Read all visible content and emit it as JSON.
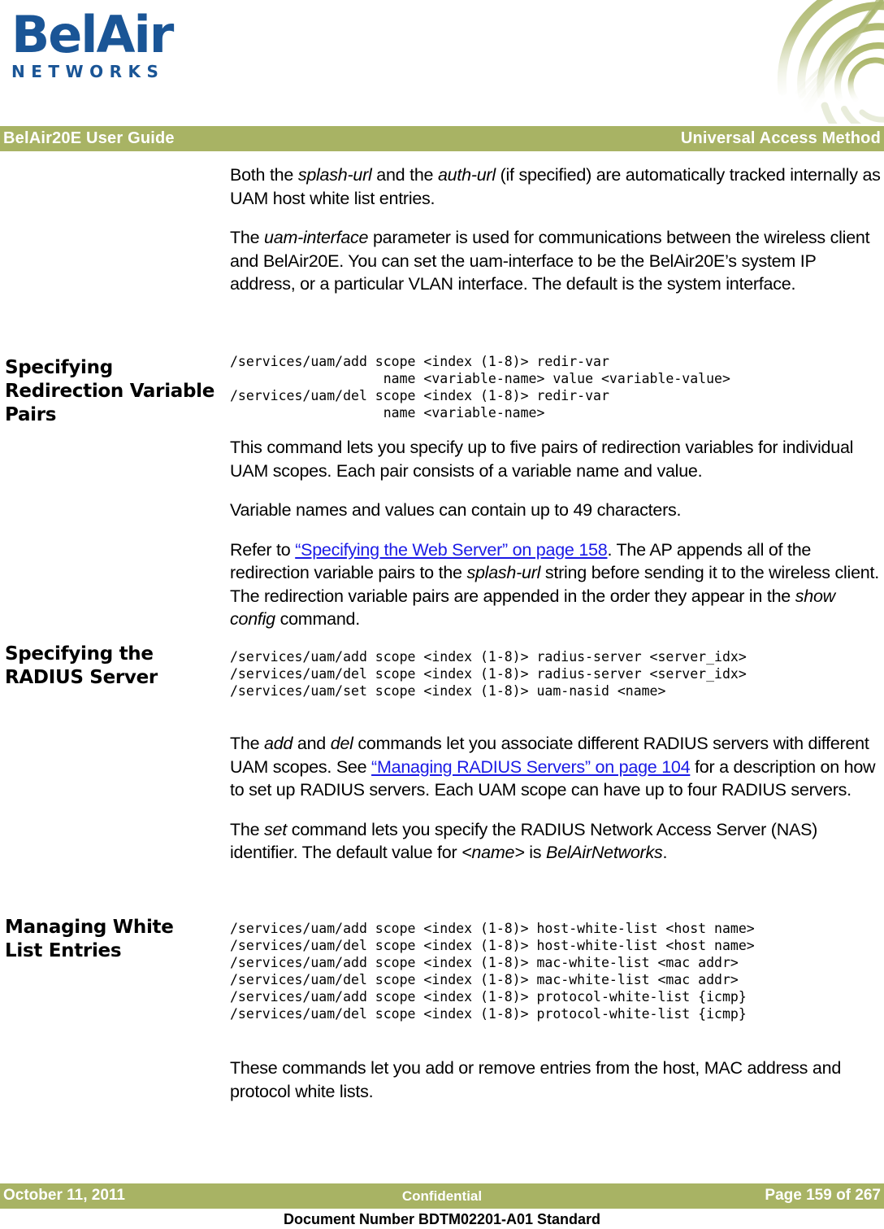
{
  "logo": {
    "wordmark": "BelAir",
    "tagline": "NETWORKS",
    "brand_color": "#1a5596",
    "corner_art_icon": "network-arcs-graphic"
  },
  "header": {
    "left_title": "BelAir20E User Guide",
    "right_title": "Universal Access Method",
    "bar_color": "#a8b364",
    "text_color": "#ffffff"
  },
  "sections": [
    {
      "heading": "",
      "paragraphs": [
        {
          "id": "p1",
          "runs": [
            {
              "text": "Both the ",
              "style": "normal"
            },
            {
              "text": "splash-url",
              "style": "italic"
            },
            {
              "text": " and the ",
              "style": "normal"
            },
            {
              "text": "auth-url",
              "style": "italic"
            },
            {
              "text": " (if specified) are automatically tracked internally as UAM host white list entries.",
              "style": "normal"
            }
          ]
        },
        {
          "id": "p2",
          "runs": [
            {
              "text": "The ",
              "style": "normal"
            },
            {
              "text": "uam-interface",
              "style": "italic"
            },
            {
              "text": " parameter is used for communications between the wireless client and BelAir20E. You can set the uam-interface to be the BelAir20E’s system IP address, or a particular VLAN interface. The default is the system interface.",
              "style": "normal"
            }
          ]
        }
      ]
    },
    {
      "heading": "Specifying Redirection Variable Pairs",
      "code": "/services/uam/add scope <index (1-8)> redir-var\n                   name <variable-name> value <variable-value>\n/services/uam/del scope <index (1-8)> redir-var\n                   name <variable-name>"
    },
    {
      "heading": "Specifying the RADIUS Server",
      "code": "/services/uam/add scope <index (1-8)> radius-server <server_idx>\n/services/uam/del scope <index (1-8)> radius-server <server_idx>\n/services/uam/set scope <index (1-8)> uam-nasid <name>"
    },
    {
      "heading": "Managing White List Entries",
      "code": "/services/uam/add scope <index (1-8)> host-white-list <host name>\n/services/uam/del scope <index (1-8)> host-white-list <host name>\n/services/uam/add scope <index (1-8)> mac-white-list <mac addr>\n/services/uam/del scope <index (1-8)> mac-white-list <mac addr>\n/services/uam/add scope <index (1-8)> protocol-white-list {icmp}\n/services/uam/del scope <index (1-8)> protocol-white-list {icmp}"
    }
  ],
  "text": {
    "p_redir_1": "This command lets you specify up to five pairs of redirection variables for individual UAM scopes. Each pair consists of a variable name and value.",
    "p_redir_2": "Variable names and values can contain up to 49 characters.",
    "p_redir_3_a": "Refer to ",
    "p_redir_3_link": "“Specifying the Web Server” on page 158",
    "p_redir_3_b": ". The AP appends all of the redirection variable pairs to the ",
    "p_redir_3_it1": "splash-url",
    "p_redir_3_c": " string before sending it to the wireless client. The redirection variable pairs are appended in the order they appear in the ",
    "p_redir_3_it2": "show config",
    "p_redir_3_d": " command.",
    "p_radius_1_a": "The ",
    "p_radius_1_it1": "add",
    "p_radius_1_b": " and ",
    "p_radius_1_it2": "del",
    "p_radius_1_c": " commands let you associate different RADIUS servers with different UAM scopes. See ",
    "p_radius_1_link": "“Managing RADIUS Servers” on page 104",
    "p_radius_1_d": " for a description on how to set up RADIUS servers. Each UAM scope can have up to four RADIUS servers.",
    "p_radius_2_a": "The ",
    "p_radius_2_it1": "set",
    "p_radius_2_b": " command lets you specify the RADIUS Network Access Server (NAS) identifier. The default value for ",
    "p_radius_2_it2": "<name>",
    "p_radius_2_c": " is ",
    "p_radius_2_it3": "BelAirNetworks",
    "p_radius_2_d": ".",
    "p_white_1": "These commands let you add or remove entries from the host, MAC address and protocol white lists."
  },
  "links": {
    "color": "#1a1ae6"
  },
  "footer": {
    "date": "October 11, 2011",
    "classification": "Confidential",
    "page": "Page 159 of 267",
    "document_number": "Document Number BDTM02201-A01 Standard",
    "bar_color": "#a8b364"
  }
}
